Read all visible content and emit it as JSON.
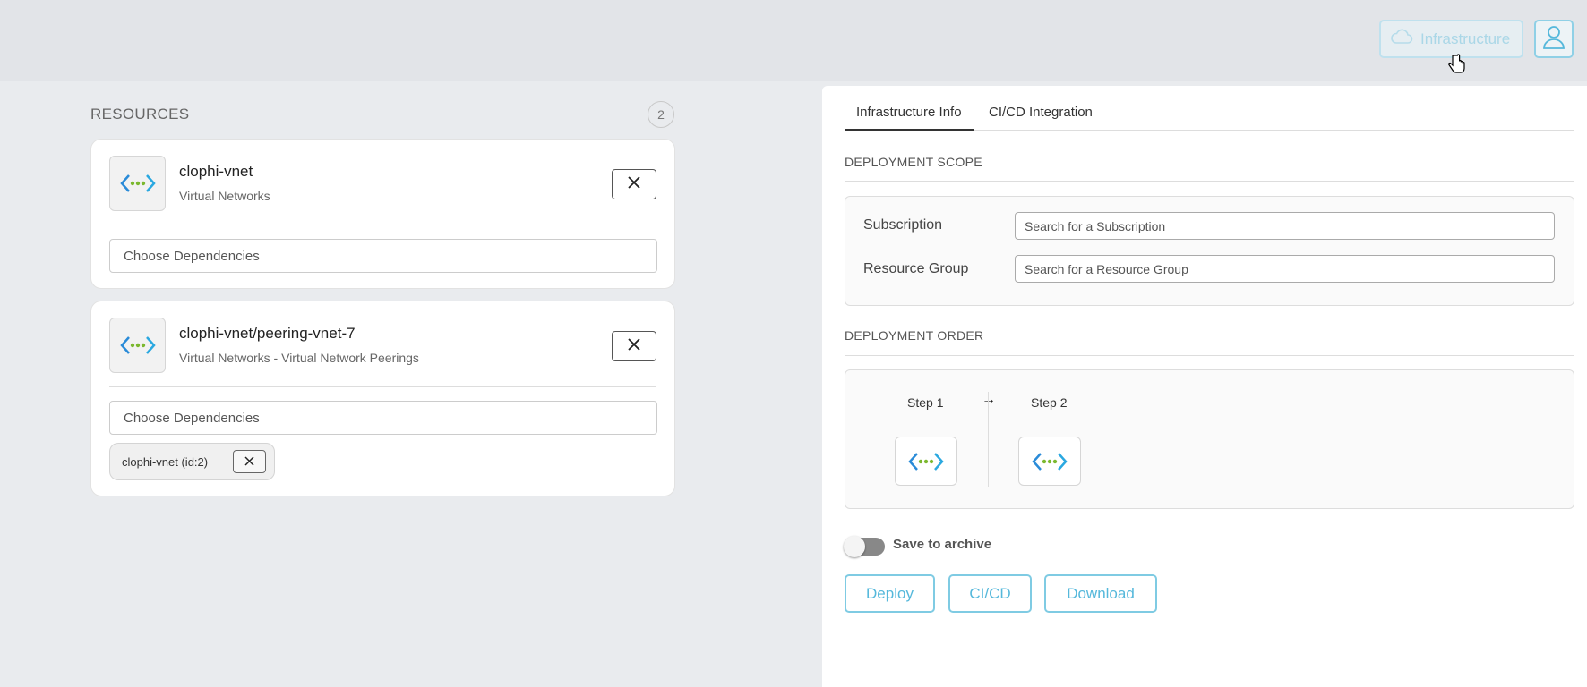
{
  "header": {
    "infrastructure_label": "Infrastructure",
    "icons": {
      "cloud": "cloud-icon",
      "user": "user-icon",
      "cursor": "hand-cursor"
    },
    "accent_color": "#7fcbe3"
  },
  "resources": {
    "title": "RESOURCES",
    "count": "2",
    "items": [
      {
        "name": "clophi-vnet",
        "type": "Virtual Networks",
        "dependencies_placeholder": "Choose Dependencies",
        "dependencies": []
      },
      {
        "name": "clophi-vnet/peering-vnet-7",
        "type": "Virtual Networks - Virtual Network Peerings",
        "dependencies_placeholder": "Choose Dependencies",
        "dependencies": [
          "clophi-vnet (id:2)"
        ]
      }
    ]
  },
  "panel": {
    "tabs": [
      {
        "label": "Infrastructure Info",
        "active": true
      },
      {
        "label": "CI/CD Integration",
        "active": false
      }
    ],
    "deployment_scope": {
      "title": "DEPLOYMENT SCOPE",
      "subscription_label": "Subscription",
      "subscription_placeholder": "Search for a Subscription",
      "resource_group_label": "Resource Group",
      "resource_group_placeholder": "Search for a Resource Group"
    },
    "deployment_order": {
      "title": "DEPLOYMENT ORDER",
      "steps": [
        "Step 1",
        "Step 2"
      ],
      "arrow": "→"
    },
    "save_to_archive": {
      "label": "Save to archive",
      "on": false
    },
    "actions": {
      "deploy": "Deploy",
      "cicd": "CI/CD",
      "download": "Download"
    }
  }
}
